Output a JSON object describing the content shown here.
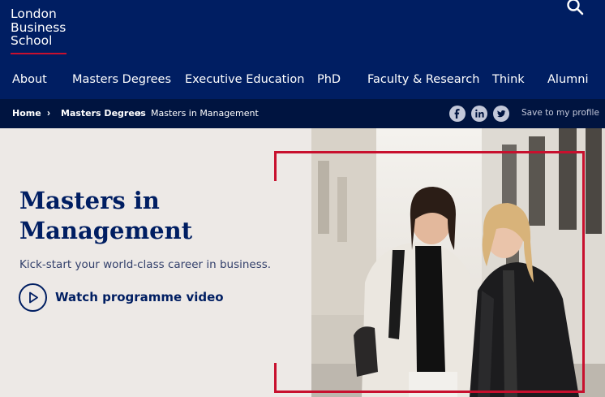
{
  "logo": {
    "lines": [
      "London",
      "Business",
      "School"
    ]
  },
  "search": {
    "icon": "search-icon"
  },
  "nav": {
    "items": [
      {
        "label": "About"
      },
      {
        "label": "Masters Degrees"
      },
      {
        "label": "Executive Education"
      },
      {
        "label": "PhD"
      },
      {
        "label": "Faculty & Research"
      },
      {
        "label": "Think"
      },
      {
        "label": "Alumni"
      }
    ]
  },
  "breadcrumb": {
    "items": [
      {
        "label": "Home"
      },
      {
        "label": "Masters Degrees"
      },
      {
        "label": "Masters in Management"
      }
    ]
  },
  "share": {
    "icons": [
      "facebook-icon",
      "linkedin-icon",
      "twitter-icon"
    ],
    "save_label": "Save to my profile"
  },
  "hero": {
    "title_lines": [
      "Masters in",
      "Management"
    ],
    "subtitle": "Kick-start your world-class career in business.",
    "video_label": "Watch programme video",
    "video_icon": "play-icon"
  },
  "colors": {
    "navy": "#001e62",
    "navy_dark": "#001440",
    "accent_red": "#c8102e",
    "hero_bg": "#ede9e6"
  }
}
